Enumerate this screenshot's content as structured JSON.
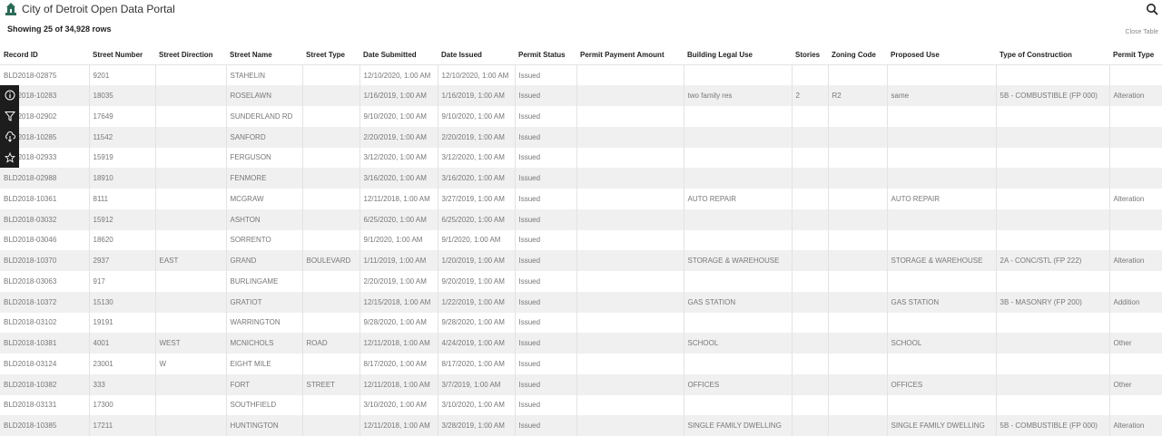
{
  "app": {
    "title": "City of Detroit Open Data Portal"
  },
  "rowcount": "Showing 25 of 34,928 rows",
  "close_table": "Close Table",
  "columns": [
    "Record ID",
    "Street Number",
    "Street Direction",
    "Street Name",
    "Street Type",
    "Date Submitted",
    "Date Issued",
    "Permit Status",
    "Permit Payment Amount",
    "Building Legal Use",
    "Stories",
    "Zoning Code",
    "Proposed Use",
    "Type of Construction",
    "Permit Type"
  ],
  "rows": [
    [
      "BLD2018-02875",
      "9201",
      "",
      "STAHELIN",
      "",
      "12/10/2020, 1:00 AM",
      "12/10/2020, 1:00 AM",
      "Issued",
      "",
      "",
      "",
      "",
      "",
      "",
      ""
    ],
    [
      "BLD2018-10283",
      "18035",
      "",
      "ROSELAWN",
      "",
      "1/16/2019, 1:00 AM",
      "1/16/2019, 1:00 AM",
      "Issued",
      "",
      "two family res",
      "2",
      "R2",
      "same",
      "5B - COMBUSTIBLE (FP 000)",
      "Alteration"
    ],
    [
      "BLD2018-02902",
      "17649",
      "",
      "SUNDERLAND RD",
      "",
      "9/10/2020, 1:00 AM",
      "9/10/2020, 1:00 AM",
      "Issued",
      "",
      "",
      "",
      "",
      "",
      "",
      ""
    ],
    [
      "BLD2018-10285",
      "11542",
      "",
      "SANFORD",
      "",
      "2/20/2019, 1:00 AM",
      "2/20/2019, 1:00 AM",
      "Issued",
      "",
      "",
      "",
      "",
      "",
      "",
      ""
    ],
    [
      "BLD2018-02933",
      "15919",
      "",
      "FERGUSON",
      "",
      "3/12/2020, 1:00 AM",
      "3/12/2020, 1:00 AM",
      "Issued",
      "",
      "",
      "",
      "",
      "",
      "",
      ""
    ],
    [
      "BLD2018-02988",
      "18910",
      "",
      "FENMORE",
      "",
      "3/16/2020, 1:00 AM",
      "3/16/2020, 1:00 AM",
      "Issued",
      "",
      "",
      "",
      "",
      "",
      "",
      ""
    ],
    [
      "BLD2018-10361",
      "8111",
      "",
      "MCGRAW",
      "",
      "12/11/2018, 1:00 AM",
      "3/27/2019, 1:00 AM",
      "Issued",
      "",
      "AUTO REPAIR",
      "",
      "",
      "AUTO REPAIR",
      "",
      "Alteration"
    ],
    [
      "BLD2018-03032",
      "15912",
      "",
      "ASHTON",
      "",
      "6/25/2020, 1:00 AM",
      "6/25/2020, 1:00 AM",
      "Issued",
      "",
      "",
      "",
      "",
      "",
      "",
      ""
    ],
    [
      "BLD2018-03046",
      "18620",
      "",
      "SORRENTO",
      "",
      "9/1/2020, 1:00 AM",
      "9/1/2020, 1:00 AM",
      "Issued",
      "",
      "",
      "",
      "",
      "",
      "",
      ""
    ],
    [
      "BLD2018-10370",
      "2937",
      "EAST",
      "GRAND",
      "BOULEVARD",
      "1/11/2019, 1:00 AM",
      "1/20/2019, 1:00 AM",
      "Issued",
      "",
      "STORAGE & WAREHOUSE",
      "",
      "",
      "STORAGE & WAREHOUSE",
      "2A - CONC/STL (FP 222)",
      "Alteration"
    ],
    [
      "BLD2018-03063",
      "917",
      "",
      "BURLINGAME",
      "",
      "2/20/2019, 1:00 AM",
      "9/20/2019, 1:00 AM",
      "Issued",
      "",
      "",
      "",
      "",
      "",
      "",
      ""
    ],
    [
      "BLD2018-10372",
      "15130",
      "",
      "GRATIOT",
      "",
      "12/15/2018, 1:00 AM",
      "1/22/2019, 1:00 AM",
      "Issued",
      "",
      "GAS STATION",
      "",
      "",
      "GAS STATION",
      "3B - MASONRY (FP 200)",
      "Addition"
    ],
    [
      "BLD2018-03102",
      "19191",
      "",
      "WARRINGTON",
      "",
      "9/28/2020, 1:00 AM",
      "9/28/2020, 1:00 AM",
      "Issued",
      "",
      "",
      "",
      "",
      "",
      "",
      ""
    ],
    [
      "BLD2018-10381",
      "4001",
      "WEST",
      "MCNICHOLS",
      "ROAD",
      "12/11/2018, 1:00 AM",
      "4/24/2019, 1:00 AM",
      "Issued",
      "",
      "SCHOOL",
      "",
      "",
      "SCHOOL",
      "",
      "Other"
    ],
    [
      "BLD2018-03124",
      "23001",
      "W",
      "EIGHT MILE",
      "",
      "8/17/2020, 1:00 AM",
      "8/17/2020, 1:00 AM",
      "Issued",
      "",
      "",
      "",
      "",
      "",
      "",
      ""
    ],
    [
      "BLD2018-10382",
      "333",
      "",
      "FORT",
      "STREET",
      "12/11/2018, 1:00 AM",
      "3/7/2019, 1:00 AM",
      "Issued",
      "",
      "OFFICES",
      "",
      "",
      "OFFICES",
      "",
      "Other"
    ],
    [
      "BLD2018-03131",
      "17300",
      "",
      "SOUTHFIELD",
      "",
      "3/10/2020, 1:00 AM",
      "3/10/2020, 1:00 AM",
      "Issued",
      "",
      "",
      "",
      "",
      "",
      "",
      ""
    ],
    [
      "BLD2018-10385",
      "17211",
      "",
      "HUNTINGTON",
      "",
      "12/11/2018, 1:00 AM",
      "3/28/2019, 1:00 AM",
      "Issued",
      "",
      "SINGLE FAMILY DWELLING",
      "",
      "",
      "SINGLE FAMILY DWELLING",
      "5B - COMBUSTIBLE (FP 000)",
      "Alteration"
    ]
  ],
  "sidebar": {
    "icons": [
      "info-icon",
      "filter-icon",
      "download-icon",
      "star-icon"
    ]
  },
  "colors": {
    "sidebar_bg": "#1d1d1d",
    "stripe": "#f0f0f0",
    "logo": "#2b6b57"
  }
}
